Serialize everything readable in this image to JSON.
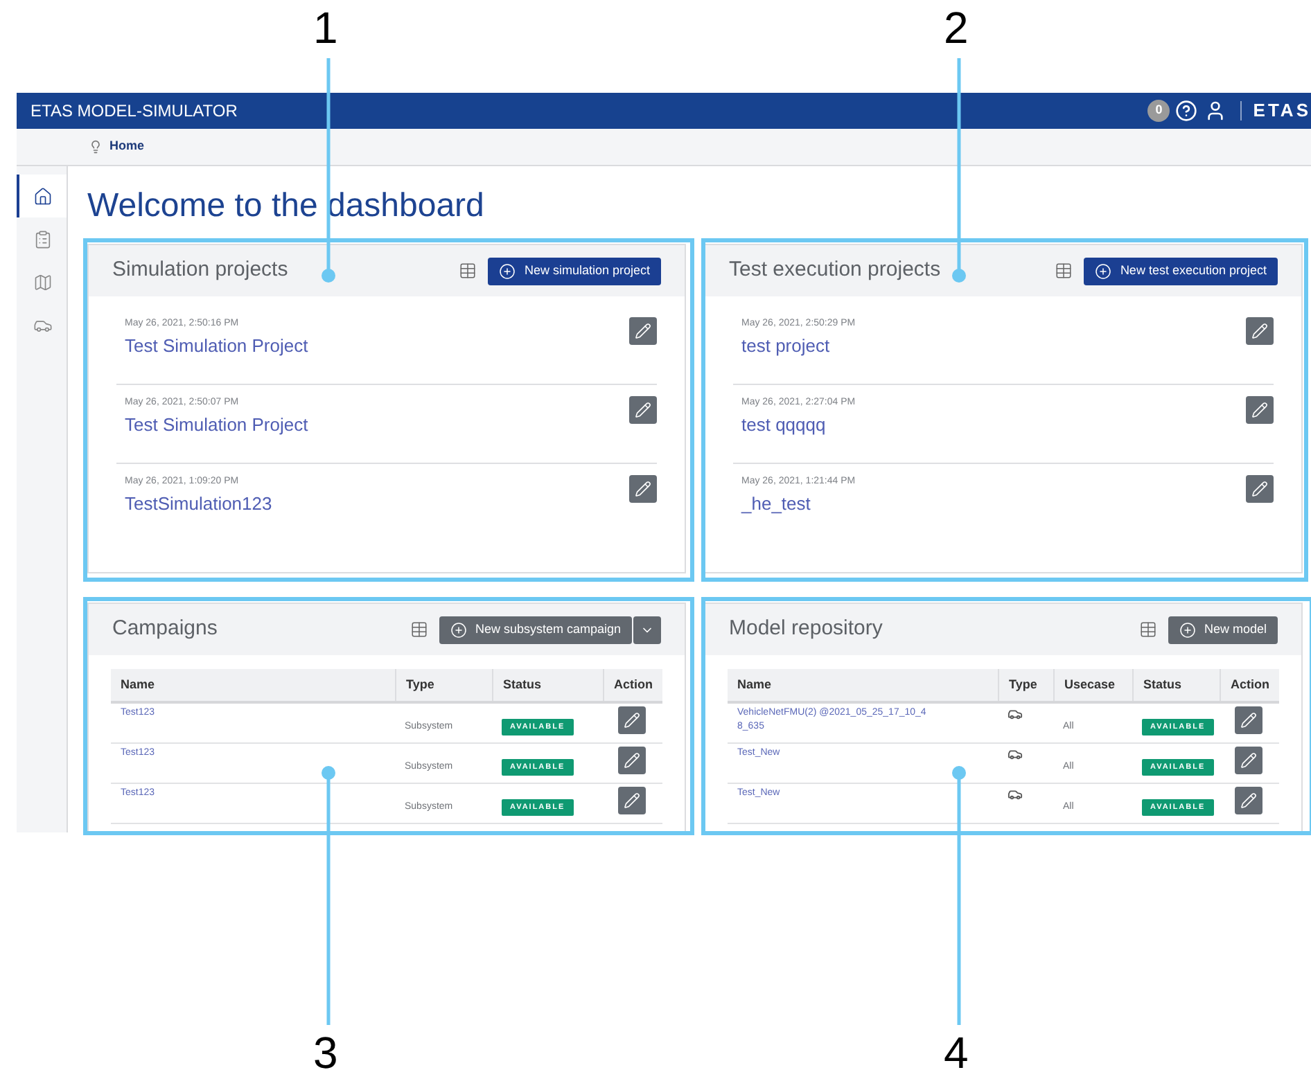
{
  "header": {
    "title": "ETAS MODEL-SIMULATOR",
    "notification_count": "0",
    "brand": "ETAS"
  },
  "breadcrumb": {
    "label": "Home"
  },
  "sidebar": {
    "items": [
      {
        "selected": true
      },
      {
        "selected": false
      },
      {
        "selected": false
      },
      {
        "selected": false
      }
    ]
  },
  "page_title": "Welcome to the dashboard",
  "simulation_projects": {
    "title": "Simulation projects",
    "button": "New simulation project",
    "items": [
      {
        "date": "May 26, 2021, 2:50:16 PM",
        "name": "Test Simulation Project"
      },
      {
        "date": "May 26, 2021, 2:50:07 PM",
        "name": "Test Simulation Project"
      },
      {
        "date": "May 26, 2021, 1:09:20 PM",
        "name": "TestSimulation123"
      }
    ]
  },
  "test_execution_projects": {
    "title": "Test execution projects",
    "button": "New test execution project",
    "items": [
      {
        "date": "May 26, 2021, 2:50:29 PM",
        "name": "test project"
      },
      {
        "date": "May 26, 2021, 2:27:04 PM",
        "name": "test qqqqq"
      },
      {
        "date": "May 26, 2021, 1:21:44 PM",
        "name": "_he_test"
      }
    ]
  },
  "campaigns": {
    "title": "Campaigns",
    "button": "New subsystem campaign",
    "columns": [
      "Name",
      "Type",
      "Status",
      "Action"
    ],
    "rows": [
      {
        "name": "Test123",
        "type": "Subsystem",
        "status": "AVAILABLE"
      },
      {
        "name": "Test123",
        "type": "Subsystem",
        "status": "AVAILABLE"
      },
      {
        "name": "Test123",
        "type": "Subsystem",
        "status": "AVAILABLE"
      }
    ]
  },
  "model_repository": {
    "title": "Model repository",
    "button": "New model",
    "columns": [
      "Name",
      "Type",
      "Usecase",
      "Status",
      "Action"
    ],
    "rows": [
      {
        "name": "VehicleNetFMU(2) @2021_05_25_17_10_48_635",
        "usecase": "All",
        "status": "AVAILABLE"
      },
      {
        "name": "Test_New",
        "usecase": "All",
        "status": "AVAILABLE"
      },
      {
        "name": "Test_New",
        "usecase": "All",
        "status": "AVAILABLE"
      }
    ]
  },
  "callouts": [
    {
      "number": "1"
    },
    {
      "number": "2"
    },
    {
      "number": "3"
    },
    {
      "number": "4"
    }
  ]
}
